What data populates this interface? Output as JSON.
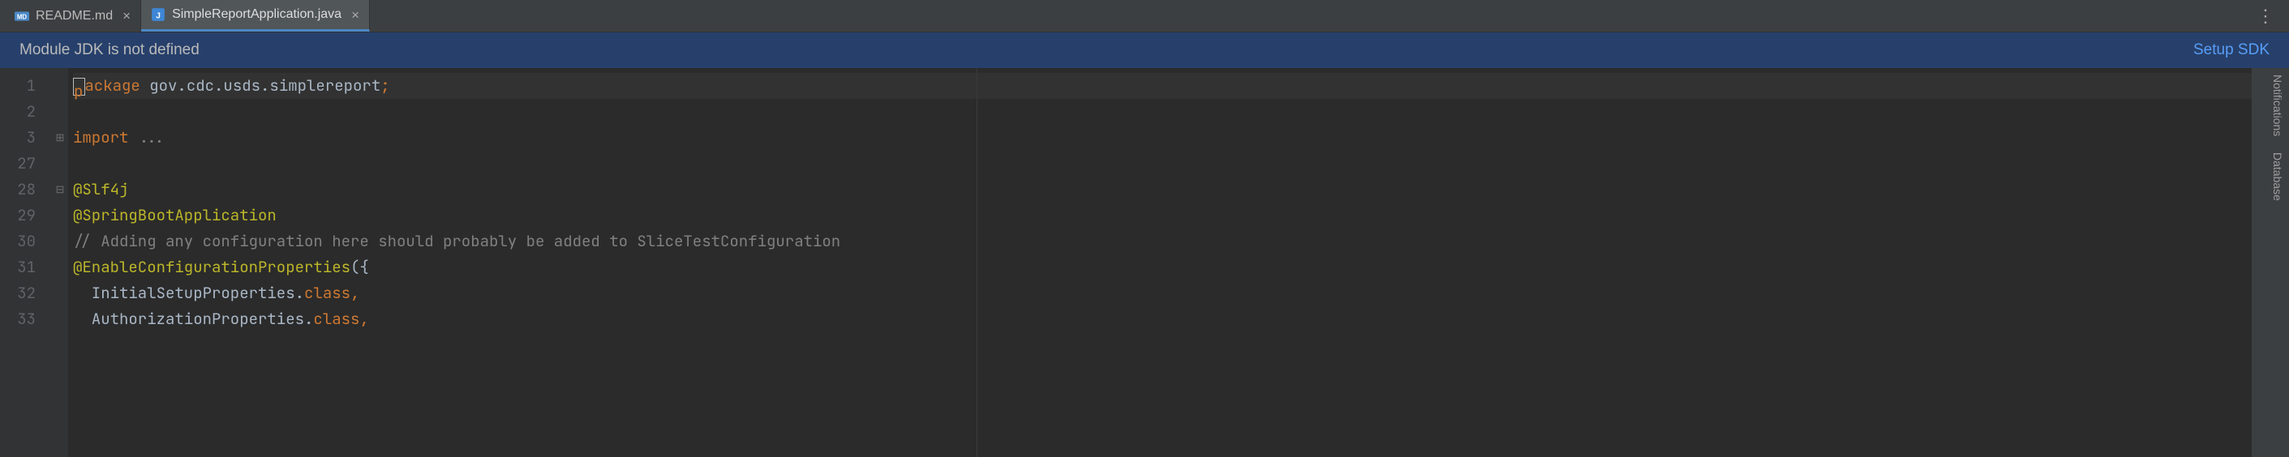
{
  "tabs": [
    {
      "label": "README.md",
      "icon": "md",
      "active": false
    },
    {
      "label": "SimpleReportApplication.java",
      "icon": "java",
      "active": true
    }
  ],
  "banner": {
    "message": "Module JDK is not defined",
    "action": "Setup SDK"
  },
  "gutter_line_numbers": [
    "1",
    "2",
    "3",
    "27",
    "28",
    "29",
    "30",
    "31",
    "32",
    "33"
  ],
  "code": {
    "lines": [
      {
        "n": "1",
        "kind": "cursor",
        "tokens": [
          {
            "t": "package",
            "c": "kw",
            "caret": true
          },
          {
            "t": " gov.cdc.usds.simplereport",
            "c": "pkg"
          },
          {
            "t": ";",
            "c": "punct"
          }
        ]
      },
      {
        "n": "2",
        "kind": "blank",
        "tokens": []
      },
      {
        "n": "3",
        "kind": "folded",
        "tokens": [
          {
            "t": "import",
            "c": "kw"
          },
          {
            "t": " ",
            "c": "pkg"
          },
          {
            "t": "...",
            "c": "dots"
          }
        ]
      },
      {
        "n": "27",
        "kind": "blank",
        "tokens": []
      },
      {
        "n": "28",
        "kind": "code",
        "tokens": [
          {
            "t": "@Slf4j",
            "c": "anno"
          }
        ]
      },
      {
        "n": "29",
        "kind": "code",
        "tokens": [
          {
            "t": "@SpringBootApplication",
            "c": "anno"
          }
        ]
      },
      {
        "n": "30",
        "kind": "code",
        "tokens": [
          {
            "t": "// Adding any configuration here should probably be added to SliceTestConfiguration",
            "c": "comment"
          }
        ]
      },
      {
        "n": "31",
        "kind": "code",
        "tokens": [
          {
            "t": "@EnableConfigurationProperties",
            "c": "anno"
          },
          {
            "t": "({",
            "c": "ident"
          }
        ]
      },
      {
        "n": "32",
        "kind": "code",
        "tokens": [
          {
            "t": "  InitialSetupProperties",
            "c": "ident"
          },
          {
            "t": ".",
            "c": "ident"
          },
          {
            "t": "class",
            "c": "kw"
          },
          {
            "t": ",",
            "c": "punct"
          }
        ]
      },
      {
        "n": "33",
        "kind": "code",
        "tokens": [
          {
            "t": "  AuthorizationProperties",
            "c": "ident"
          },
          {
            "t": ".",
            "c": "ident"
          },
          {
            "t": "class",
            "c": "kw"
          },
          {
            "t": ",",
            "c": "punct"
          }
        ]
      }
    ]
  },
  "right_rail": [
    "Notifications",
    "Database"
  ]
}
